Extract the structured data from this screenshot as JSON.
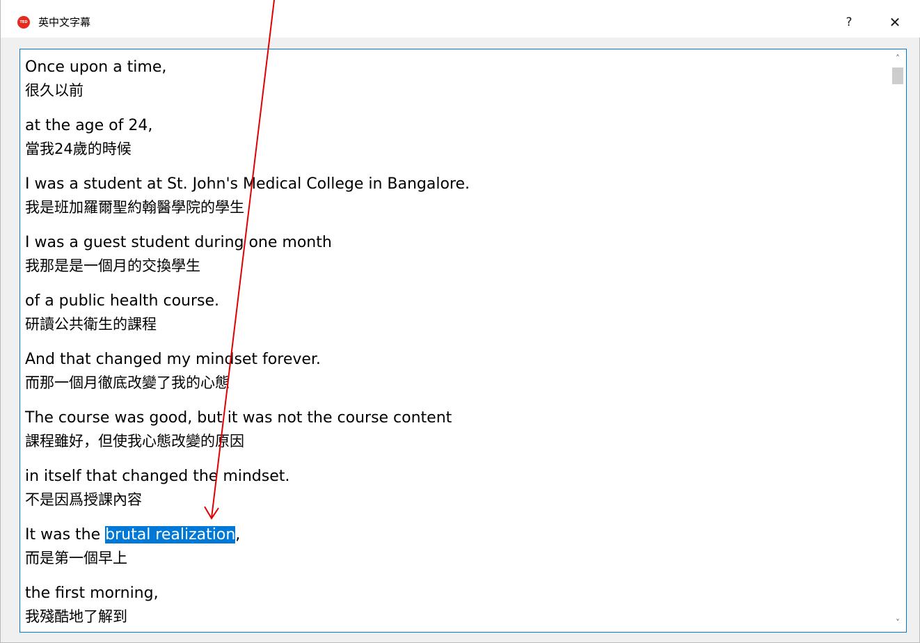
{
  "window": {
    "title": "英中文字幕",
    "app_icon_label": "TED",
    "help_label": "?",
    "close_label": "✕"
  },
  "subtitles": [
    {
      "en": "Once upon a time,",
      "zh": "很久以前"
    },
    {
      "en": "at the age of 24,",
      "zh": "當我24歲的時候"
    },
    {
      "en": "I was a student at St. John's Medical College in Bangalore.",
      "zh": "我是班加羅爾聖約翰醫學院的學生"
    },
    {
      "en": "I was a guest student during one month",
      "zh": "我那是是一個月的交換學生"
    },
    {
      "en": "of a public health course.",
      "zh": "研讀公共衛生的課程"
    },
    {
      "en": "And that changed my mindset forever.",
      "zh": "而那一個月徹底改變了我的心態"
    },
    {
      "en": "The course was good, but it was not the course content",
      "zh": "課程雖好，但使我心態改變的原因"
    },
    {
      "en": "in itself that changed the mindset.",
      "zh": "不是因爲授課內容"
    },
    {
      "en_before": "It was the ",
      "en_selected": "brutal realization",
      "en_after": ",",
      "zh": "而是第一個早上"
    },
    {
      "en": "the first morning,",
      "zh": "我殘酷地了解到"
    }
  ],
  "scrollbar": {
    "up_icon": "chevron-up-icon",
    "down_icon": "chevron-down-icon",
    "up_glyph": "˄",
    "down_glyph": "˅"
  },
  "colors": {
    "selection": "#0078d7",
    "focus_border": "#0078d7",
    "annotation_arrow": "#e00000",
    "ted_red": "#e62b1e"
  }
}
